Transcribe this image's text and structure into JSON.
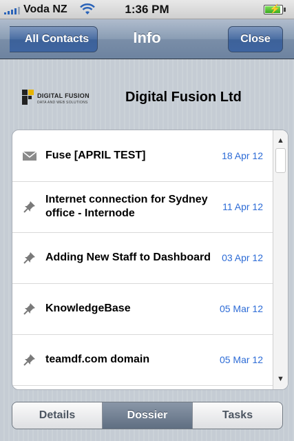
{
  "status_bar": {
    "carrier": "Voda NZ",
    "time": "1:36 PM",
    "signal_icon": "signal-bars-icon",
    "wifi_icon": "wifi-icon",
    "battery_icon": "battery-charging-icon",
    "battery_level": 0.9
  },
  "nav": {
    "back_label": "All Contacts",
    "title": "Info",
    "close_label": "Close"
  },
  "company": {
    "logo_text": "DIGITAL FUSION",
    "logo_subtext": "DATA AND WEB SOLUTIONS",
    "name": "Digital Fusion Ltd"
  },
  "dossier": {
    "items": [
      {
        "icon": "mail-icon",
        "title": "Fuse [APRIL TEST]",
        "date": "18 Apr 12"
      },
      {
        "icon": "pin-icon",
        "title": "Internet connection for Sydney office - Internode",
        "date": "11 Apr 12"
      },
      {
        "icon": "pin-icon",
        "title": "Adding New Staff to Dashboard",
        "date": "03 Apr 12"
      },
      {
        "icon": "pin-icon",
        "title": "KnowledgeBase",
        "date": "05 Mar 12"
      },
      {
        "icon": "pin-icon",
        "title": "teamdf.com domain",
        "date": "05 Mar 12"
      }
    ],
    "scroll_up_icon": "scroll-up-arrow-icon",
    "scroll_down_icon": "scroll-down-arrow-icon"
  },
  "tabs": {
    "items": [
      {
        "label": "Details",
        "active": false
      },
      {
        "label": "Dossier",
        "active": true
      },
      {
        "label": "Tasks",
        "active": false
      }
    ]
  },
  "colors": {
    "accent": "#2c6bd6",
    "nav_bar": "#7a8ea8",
    "active_segment": "#6a788c"
  }
}
